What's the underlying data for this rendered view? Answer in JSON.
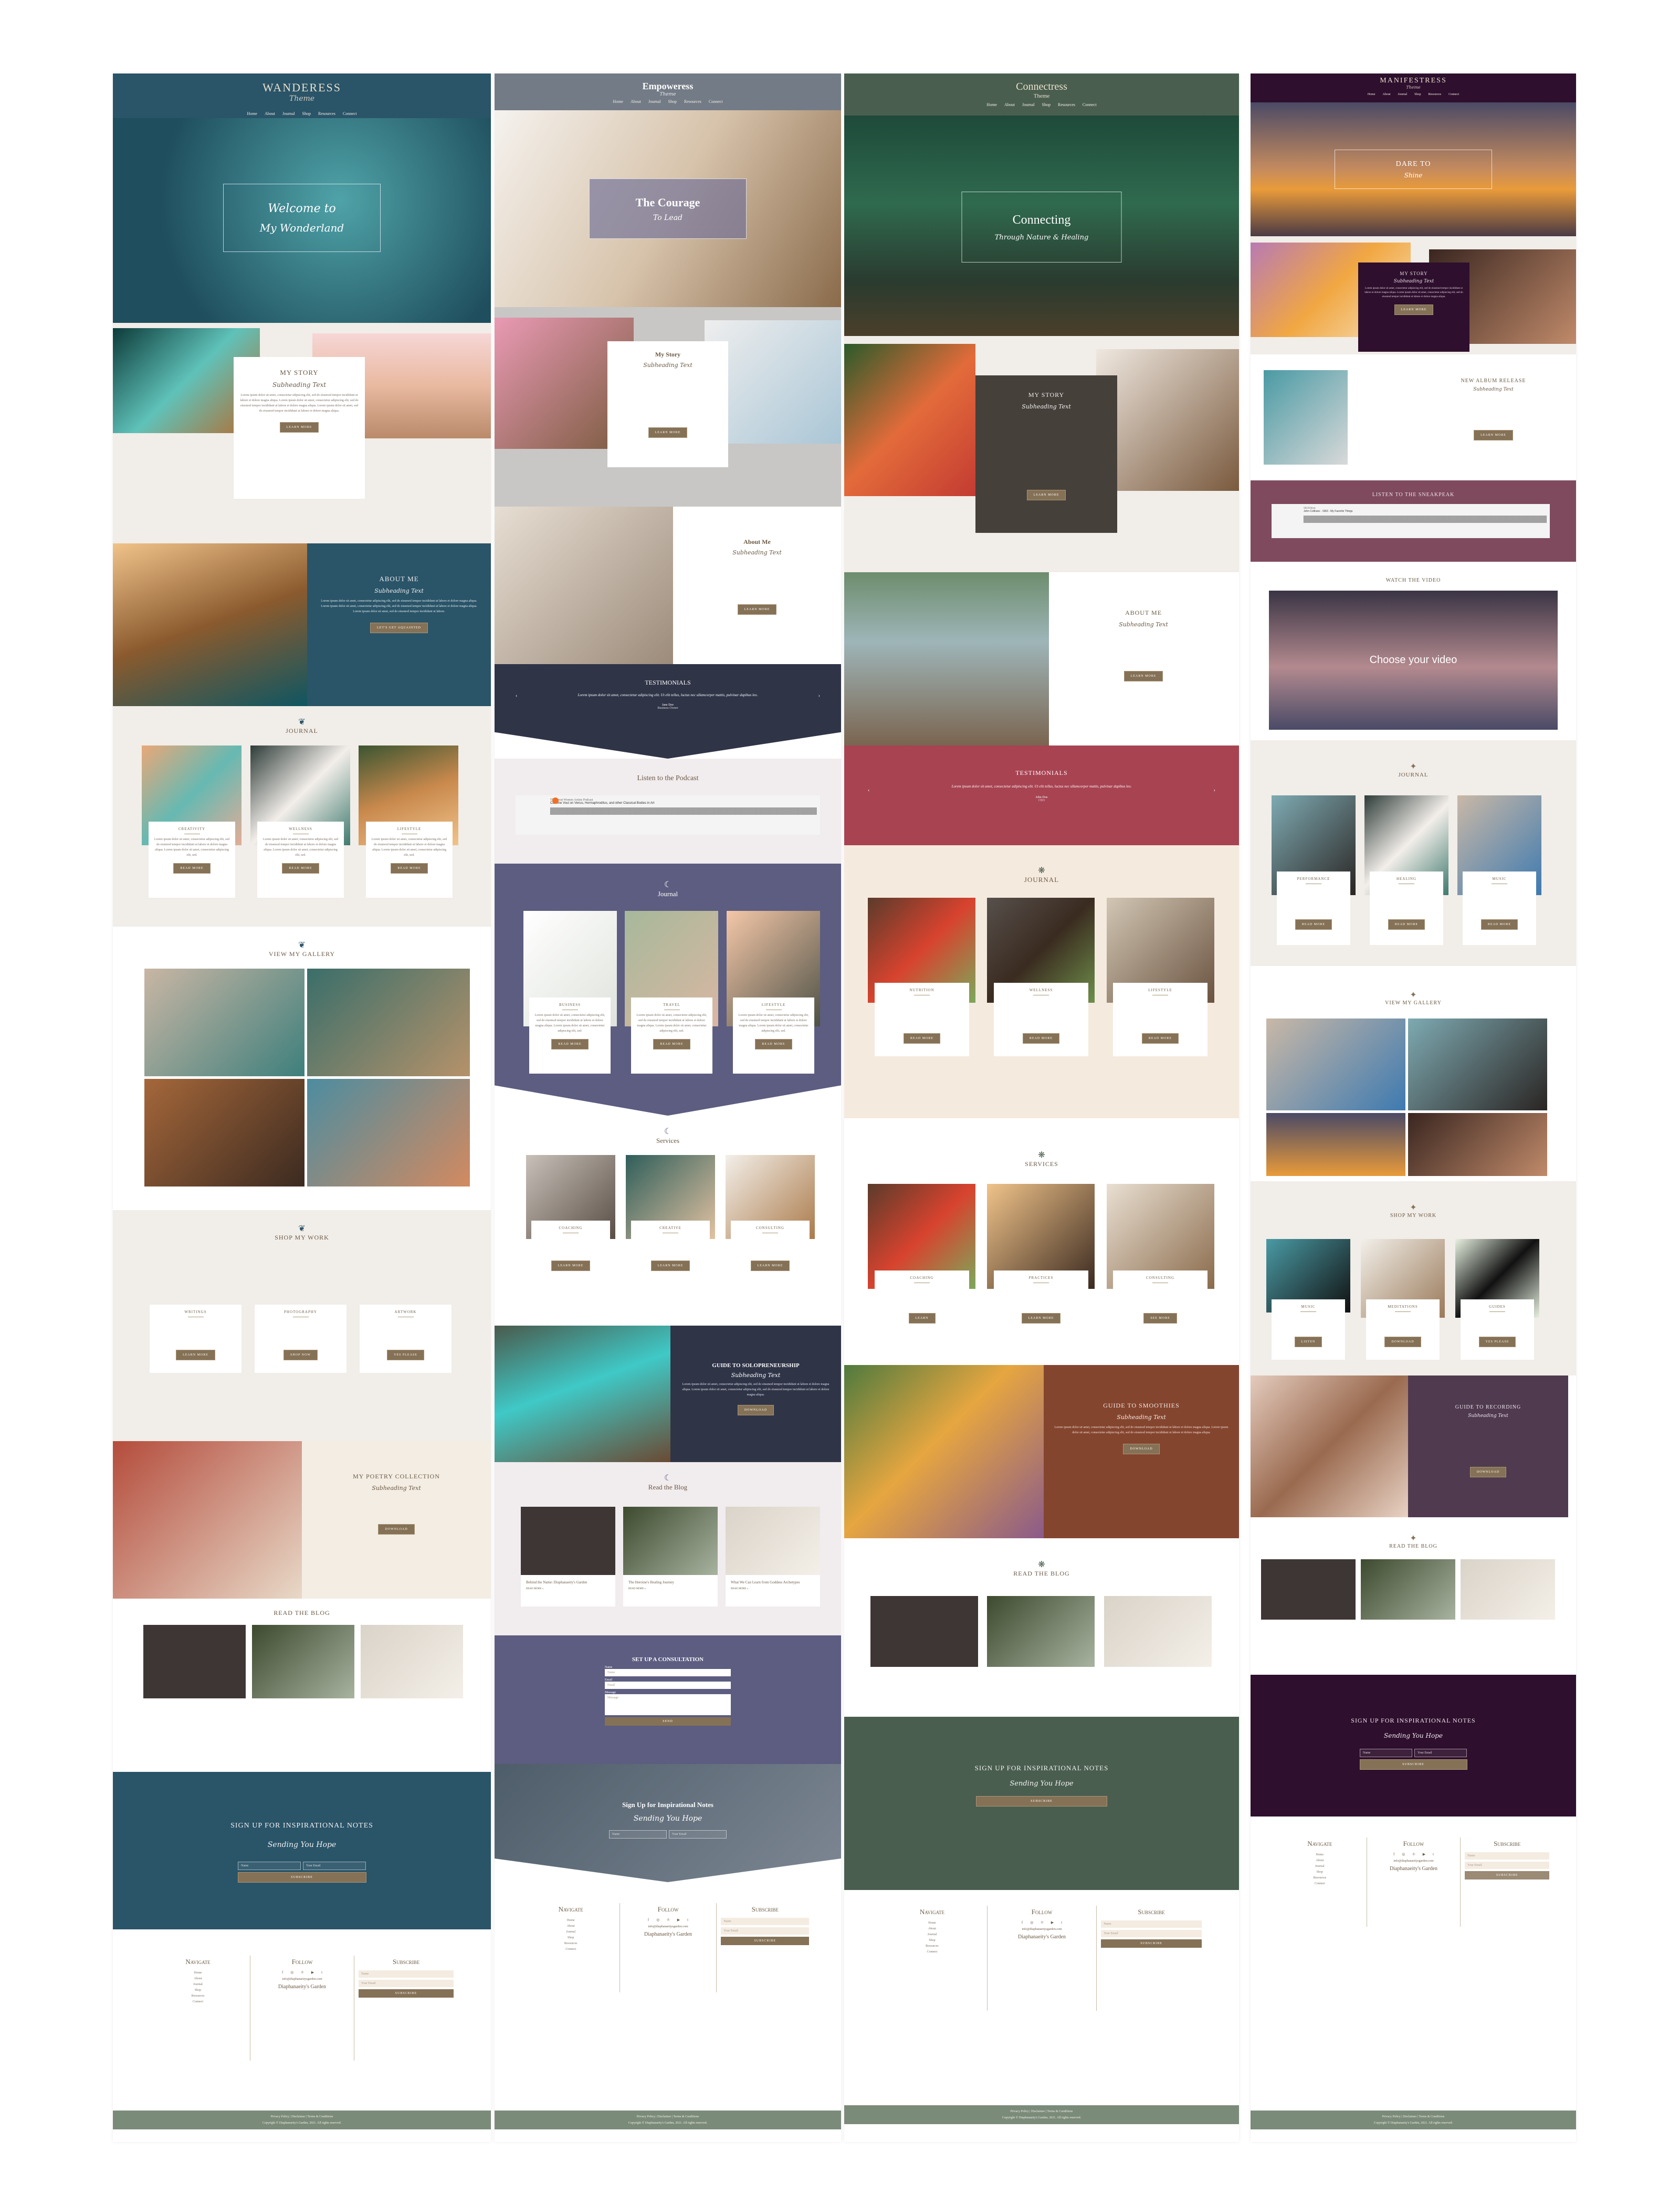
{
  "nav_items": [
    "Home",
    "About",
    "Journal",
    "Shop",
    "Resources",
    "Connect"
  ],
  "colors": {
    "wanderess": "#2a5468",
    "empoweress_header": "#737b86",
    "empoweress_navy": "#2f3447",
    "empoweress_purple": "#5c5d80",
    "connectress": "#4a5e4f",
    "connectress_rose": "#a84352",
    "connectress_rust": "#84452f",
    "manifestress": "#2e0f2d",
    "manifestress_plum": "#7f4a5e",
    "button": "#857156",
    "footer_bar": "#7b8b7a"
  },
  "wanderess": {
    "logo": "WANDERESS",
    "logo_sub": "Theme",
    "hero_line1": "Welcome to",
    "hero_line2": "My Wonderland",
    "story": {
      "title": "MY STORY",
      "subtitle": "Subheading Text",
      "body": "Lorem ipsum dolor sit amet, consectetur adipiscing elit, sed do eiusmod tempor incididunt ut labore et dolore magna aliqua. Lorem ipsum dolor sit amet, consectetur adipiscing elit, sed do eiusmod tempor incididunt ut labore et dolore magna aliqua. Lorem ipsum dolor sit amet, sed do eiusmod tempor incididunt ut labore et dolore magna aliqua.",
      "button": "LEARN MORE"
    },
    "about": {
      "title": "ABOUT ME",
      "subtitle": "Subheading Text",
      "body": "Lorem ipsum dolor sit amet, consectetur adipiscing elit, sed do eiusmod tempor incididunt ut labore et dolore magna aliqua. Lorem ipsum dolor sit amet, consectetur adipiscing elit, sed do eiusmod tempor incididunt ut labore et dolore magna aliqua. Lorem ipsum dolor sit amet, sed do eiusmod tempor incididunt ut labore.",
      "button": "LET'S GET AQUAINTED"
    },
    "journal": {
      "title": "JOURNAL",
      "cards": [
        {
          "title": "CREATIVITY",
          "body": "Lorem ipsum dolor sit amet, consectetur adipiscing elit, sed do eiusmod tempor incididunt ut labore et dolore magna aliqua. Lorem ipsum dolor sit amet, consectetur adipiscing elit, sed.",
          "button": "READ MORE"
        },
        {
          "title": "WELLNESS",
          "body": "Lorem ipsum dolor sit amet, consectetur adipiscing elit, sed do eiusmod tempor incididunt ut labore et dolore magna aliqua. Lorem ipsum dolor sit amet, consectetur adipiscing elit, sed.",
          "button": "READ MORE"
        },
        {
          "title": "LIFESTYLE",
          "body": "Lorem ipsum dolor sit amet, consectetur adipiscing elit, sed do eiusmod tempor incididunt ut labore et dolore magna aliqua. Lorem ipsum dolor sit amet, consectetur adipiscing elit, sed.",
          "button": "READ MORE"
        }
      ]
    },
    "gallery_title": "VIEW MY GALLERY",
    "shop": {
      "title": "SHOP MY WORK",
      "cards": [
        {
          "title": "WRITINGS",
          "button": "LEARN MORE"
        },
        {
          "title": "PHOTOGRAPHY",
          "button": "SHOP NOW"
        },
        {
          "title": "ARTWORK",
          "button": "YES PLEASE"
        }
      ]
    },
    "poetry": {
      "title": "MY POETRY COLLECTION",
      "subtitle": "Subheading Text",
      "button": "DOWNLOAD"
    },
    "blog": {
      "title": "READ THE BLOG"
    },
    "signup": {
      "title": "SIGN UP FOR INSPIRATIONAL NOTES",
      "subtitle": "Sending You Hope",
      "name_placeholder": "Name",
      "email_placeholder": "Your Email",
      "button": "SUBSCRIBE"
    }
  },
  "empoweress": {
    "logo": "Empoweress",
    "logo_sub": "Theme",
    "hero_line1": "The Courage",
    "hero_line2": "To Lead",
    "story": {
      "title": "My Story",
      "subtitle": "Subheading Text",
      "button": "LEARN MORE"
    },
    "about": {
      "title": "About Me",
      "subtitle": "Subheading Text",
      "button": "LEARN MORE"
    },
    "testimonials": {
      "title": "TESTIMONIALS",
      "quote": "Lorem ipsum dolor sit amet, consectetur adipiscing elit. Ut elit tellus, luctus nec ullamcorper mattis, pulvinar dapibus leo.",
      "name": "Jane Doe",
      "role": "Business Owner"
    },
    "podcast": {
      "title": "Listen to the Podcast",
      "show": "The Great Women Artists Podcast",
      "episode": "Caroline Vout on Venus, Hermaphroditus, and other Classical Bodies in Art",
      "share": "Share",
      "privacy": "Privacy policy"
    },
    "journal": {
      "title": "Journal",
      "cards": [
        {
          "title": "BUSINESS",
          "button": "READ MORE"
        },
        {
          "title": "TRAVEL",
          "button": "READ MORE"
        },
        {
          "title": "LIFESTYLE",
          "button": "READ MORE"
        }
      ],
      "body": "Lorem ipsum dolor sit amet, consectetur adipiscing elit, sed do eiusmod tempor incididunt ut labore et dolore magna aliqua. Lorem ipsum dolor sit amet, consectetur adipiscing elit, sed."
    },
    "services": {
      "title": "Services",
      "cards": [
        {
          "title": "COACHING",
          "button": "LEARN MORE"
        },
        {
          "title": "CREATIVE",
          "button": "LEARN MORE"
        },
        {
          "title": "CONSULTING",
          "button": "LEARN MORE"
        }
      ]
    },
    "guide": {
      "title": "GUIDE TO SOLOPRENEURSHIP",
      "subtitle": "Subheading Text",
      "body": "Lorem ipsum dolor sit amet, consectetur adipiscing elit, sed do eiusmod tempor incididunt ut labore et dolore magna aliqua. Lorem ipsum dolor sit amet, consectetur adipiscing elit, sed do eiusmod tempor incididunt ut labore et dolore magna aliqua.",
      "button": "DOWNLOAD"
    },
    "blog": {
      "title": "Read the Blog",
      "posts": [
        {
          "title": "Behind the Name: Diaphanaeity's Garden",
          "link": "READ MORE »"
        },
        {
          "title": "The Heroine's Healing Journey",
          "link": "READ MORE »"
        },
        {
          "title": "What We Can Learn from Goddess Archetypes",
          "link": "READ MORE »"
        }
      ]
    },
    "consult": {
      "title": "SET UP A CONSULTATION",
      "name_label": "Name",
      "name_placeholder": "Name",
      "email_label": "Email",
      "email_placeholder": "Email",
      "message_label": "Message",
      "message_placeholder": "Message",
      "button": "SEND"
    },
    "signup": {
      "title": "Sign Up for Inspirational Notes",
      "subtitle": "Sending You Hope",
      "name_placeholder": "Name",
      "email_placeholder": "Your Email",
      "button": "SUBSCRIBE"
    }
  },
  "connectress": {
    "logo": "Connectress",
    "logo_sub": "Theme",
    "hero_line1": "Connecting",
    "hero_line2": "Through Nature & Healing",
    "story": {
      "title": "MY STORY",
      "subtitle": "Subheading Text",
      "button": "LEARN MORE"
    },
    "about": {
      "title": "ABOUT ME",
      "subtitle": "Subheading Text",
      "button": "LEARN MORE"
    },
    "testimonials": {
      "title": "TESTIMONIALS",
      "quote": "Lorem ipsum dolor sit amet, consectetur adipiscing elit. Ut elit tellus, luctus nec ullamcorper mattis, pulvinar dapibus leo.",
      "name": "John Doe",
      "role": "CEO"
    },
    "journal": {
      "title": "JOURNAL",
      "cards": [
        {
          "title": "NUTRITION",
          "button": "READ MORE"
        },
        {
          "title": "WELLNESS",
          "button": "READ MORE"
        },
        {
          "title": "LIFESTYLE",
          "button": "READ MORE"
        }
      ]
    },
    "services": {
      "title": "SERVICES",
      "cards": [
        {
          "title": "COACHING",
          "button": "LEARN"
        },
        {
          "title": "PRACTICES",
          "button": "LEARN MORE"
        },
        {
          "title": "CONSULTING",
          "button": "SEE MORE"
        }
      ]
    },
    "guide": {
      "title": "GUIDE TO SMOOTHIES",
      "subtitle": "Subheading Text",
      "body": "Lorem ipsum dolor sit amet, consectetur adipiscing elit, sed do eiusmod tempor incididunt ut labore et dolore magna aliqua. Lorem ipsum dolor sit amet, consectetur adipiscing elit, sed do eiusmod tempor incididunt ut labore et dolore magna aliqua.",
      "button": "DOWNLOAD"
    },
    "blog": {
      "title": "READ THE BLOG"
    },
    "signup": {
      "title": "SIGN UP FOR INSPIRATIONAL NOTES",
      "subtitle": "Sending You Hope",
      "button": "SUBSCRIBE"
    }
  },
  "manifestress": {
    "logo": "MANIFESTRESS",
    "logo_sub": "Theme",
    "hero_line1": "DARE TO",
    "hero_line2": "Shine",
    "story": {
      "title": "MY STORY",
      "subtitle": "Subheading Text",
      "body": "Lorem ipsum dolor sit amet, consectetur adipiscing elit, sed do eiusmod tempor incididunt ut labore et dolore magna aliqua. Lorem ipsum dolor sit amet, consectetur adipiscing elit, sed do eiusmod tempor incididunt ut labore et dolore magna aliqua.",
      "button": "LEARN MORE"
    },
    "album": {
      "title": "NEW ALBUM RELEASE",
      "subtitle": "Subheading Text",
      "button": "LEARN MORE"
    },
    "sneak": {
      "title": "LISTEN TO THE SNEAKPEAK",
      "artist": "SKOOlterp",
      "track": "John Coltrane - 1963 - My Favorite Things",
      "share": "Share"
    },
    "video": {
      "title": "WATCH THE VIDEO",
      "text": "Choose your video"
    },
    "journal": {
      "title": "JOURNAL",
      "cards": [
        {
          "title": "PERFORMANCE",
          "button": "READ MORE"
        },
        {
          "title": "HEALING",
          "button": "READ MORE"
        },
        {
          "title": "MUSIC",
          "button": "READ MORE"
        }
      ]
    },
    "gallery_title": "VIEW MY GALLERY",
    "shop": {
      "title": "SHOP MY WORK",
      "cards": [
        {
          "title": "MUSIC",
          "button": "LISTEN"
        },
        {
          "title": "MEDITATIONS",
          "button": "DOWNLOAD"
        },
        {
          "title": "GUIDES",
          "button": "YES PLEASE"
        }
      ]
    },
    "guide": {
      "title": "GUIDE TO RECORDING",
      "subtitle": "Subheading Text",
      "button": "DOWNLOAD"
    },
    "blog": {
      "title": "READ THE BLOG"
    },
    "signup": {
      "title": "SIGN UP FOR INSPIRATIONAL NOTES",
      "subtitle": "Sending You Hope",
      "name_placeholder": "Name",
      "email_placeholder": "Your Email",
      "button": "SUBSCRIBE"
    }
  },
  "footer": {
    "navigate": "Navigate",
    "follow": "Follow",
    "subscribe": "Subscribe",
    "links": [
      "Home",
      "About",
      "Journal",
      "Shop",
      "Resources",
      "Connect"
    ],
    "socials": [
      "f",
      "◎",
      "℗",
      "▶",
      "t"
    ],
    "email": "info@diaphanaeitysgarden.com",
    "brand": "Diaphanaeity's Garden",
    "name_placeholder": "Name",
    "email_placeholder": "Your Email",
    "button": "SUBSCRIBE",
    "legal": "Privacy Policy | Disclaimer | Terms & Conditions",
    "copyright": "Copyright © Diaphanaeity's Garden, 2021. All rights reserved."
  }
}
